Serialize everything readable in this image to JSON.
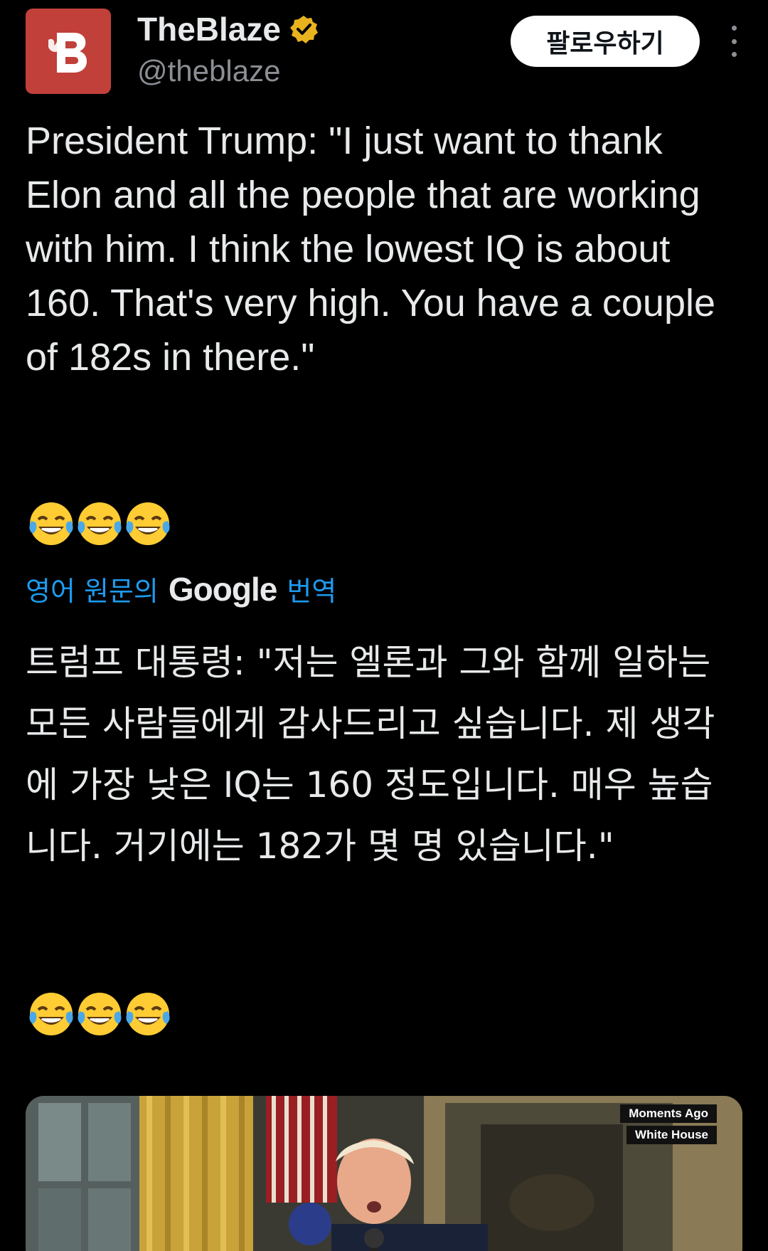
{
  "account": {
    "display_name": "TheBlaze",
    "handle": "@theblaze",
    "avatar_letter": "B",
    "brand_color": "#c1403a",
    "verified_color": "#e8b31e"
  },
  "actions": {
    "follow_label": "팔로우하기",
    "more_icon": "more-vertical-icon"
  },
  "tweet": {
    "text": "President Trump: \"I just want to thank Elon and all the people that are working with him. I think the lowest IQ is about 160. That's very high. You have a couple of 182s in there.\"",
    "emojis": "😂😂😂"
  },
  "translation": {
    "prefix": "영어 원문의",
    "brand": "Google",
    "suffix": "번역",
    "link_color": "#1d9bf0",
    "text": "트럼프 대통령: \"저는 엘론과 그와 함께 일하는 모든 사람들에게 감사드리고 싶습니다. 제 생각에 가장 낮은 IQ는 160 정도입니다. 매우 높습니다. 거기에는 182가 몇 명 있습니다.\"",
    "emojis": "😂😂😂"
  },
  "media": {
    "tag_line_1": "Moments Ago",
    "tag_line_2": "White House"
  }
}
